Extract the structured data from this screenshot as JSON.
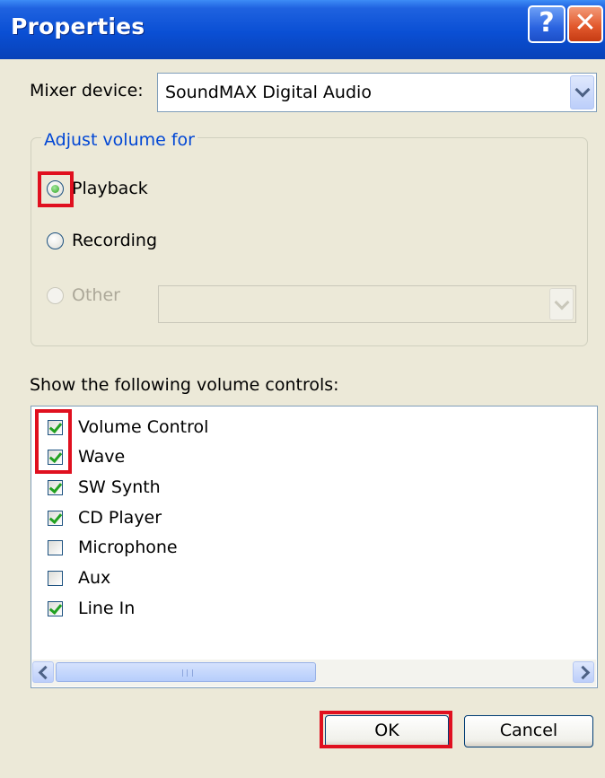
{
  "window": {
    "title": "Properties",
    "help_glyph": "?",
    "close_glyph": "✕"
  },
  "mixer": {
    "label": "Mixer device:",
    "value": "SoundMAX Digital Audio"
  },
  "adjust_group": {
    "legend": "Adjust volume for",
    "options": [
      {
        "label": "Playback",
        "selected": true,
        "enabled": true
      },
      {
        "label": "Recording",
        "selected": false,
        "enabled": true
      },
      {
        "label": "Other",
        "selected": false,
        "enabled": false
      }
    ],
    "other_value": ""
  },
  "controls": {
    "label": "Show the following volume controls:",
    "items": [
      {
        "label": "Volume Control",
        "checked": true
      },
      {
        "label": "Wave",
        "checked": true
      },
      {
        "label": "SW Synth",
        "checked": true
      },
      {
        "label": "CD Player",
        "checked": true
      },
      {
        "label": "Microphone",
        "checked": false
      },
      {
        "label": "Aux",
        "checked": false
      },
      {
        "label": "Line In",
        "checked": true
      }
    ]
  },
  "buttons": {
    "ok": "OK",
    "cancel": "Cancel"
  },
  "colors": {
    "titlebar": "#0a4fd4",
    "highlight": "#e0101f",
    "group_legend": "#0046d5",
    "check": "#21a121"
  }
}
